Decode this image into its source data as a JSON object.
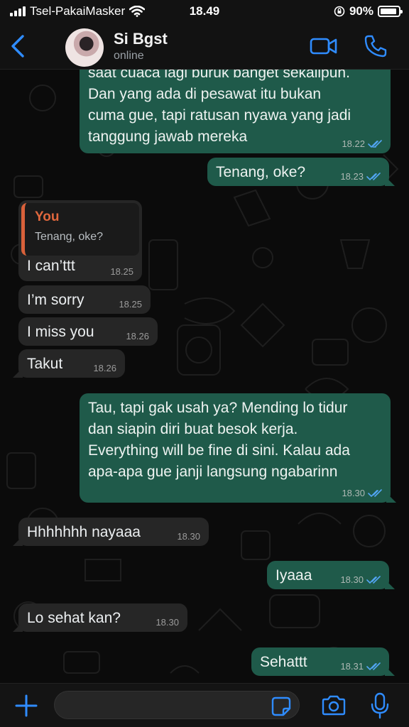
{
  "status_bar": {
    "carrier": "Tsel-PakaiMasker",
    "time": "18.49",
    "battery": "90%",
    "battery_level": 0.9
  },
  "header": {
    "contact_name": "Si Bgst",
    "contact_status": "online"
  },
  "messages": [
    {
      "type": "out",
      "text_lines": [
        "saat cuaca lagi buruk banget sekalipun.",
        "Dan yang ada di pesawat itu bukan",
        "cuma gue, tapi ratusan nyawa yang jadi",
        "tanggung jawab mereka"
      ],
      "time": "18.22",
      "status": "read"
    },
    {
      "type": "out",
      "text": "Tenang, oke?",
      "time": "18.23",
      "status": "read"
    },
    {
      "type": "in",
      "quote_author": "You",
      "quote_text": "Tenang, oke?",
      "text": "I can’ttt",
      "time": "18.25"
    },
    {
      "type": "in",
      "text": "I’m sorry",
      "time": "18.25"
    },
    {
      "type": "in",
      "text": "I miss you",
      "time": "18.26"
    },
    {
      "type": "in",
      "text": "Takut",
      "time": "18.26"
    },
    {
      "type": "out",
      "text_lines": [
        "Tau, tapi gak usah ya? Mending lo tidur",
        "dan siapin diri buat besok kerja.",
        "Everything will be fine di sini. Kalau ada",
        "apa-apa gue janji langsung ngabarinn"
      ],
      "time": "18.30",
      "status": "read"
    },
    {
      "type": "in",
      "text": "Hhhhhhh nayaaa",
      "time": "18.30"
    },
    {
      "type": "out",
      "text": "Iyaaa",
      "time": "18.30",
      "status": "read"
    },
    {
      "type": "in",
      "text": "Lo sehat kan?",
      "time": "18.30"
    },
    {
      "type": "out",
      "text": "Sehattt",
      "time": "18.31",
      "status": "read"
    }
  ],
  "icons": {
    "back": "chevron-left-icon",
    "video": "video-camera-icon",
    "call": "phone-icon",
    "plus": "plus-icon",
    "sticker": "sticker-icon",
    "camera": "camera-icon",
    "mic": "microphone-icon"
  },
  "colors": {
    "accent": "#2f8cff",
    "outgoing_bubble": "#1f5a4a",
    "incoming_bubble": "#262626",
    "read_ticks": "#53a6f5",
    "quote_author": "#e0673d"
  }
}
